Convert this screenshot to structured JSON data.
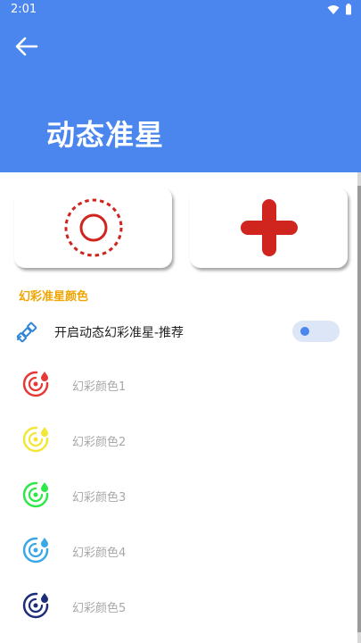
{
  "status_bar": {
    "time": "2:01"
  },
  "header": {
    "title": "动态准星",
    "color": "#4a86ee"
  },
  "cards": [
    {
      "name": "dotted-ring-crosshair"
    },
    {
      "name": "red-plus-crosshair"
    }
  ],
  "section": {
    "title": "幻彩准星颜色"
  },
  "toggle": {
    "label": "开启动态幻彩准星-推荐",
    "enabled": false
  },
  "colors": [
    {
      "label": "幻彩颜色1",
      "color": "#e53935"
    },
    {
      "label": "幻彩颜色2",
      "color": "#f2e637"
    },
    {
      "label": "幻彩颜色3",
      "color": "#2ee84a"
    },
    {
      "label": "幻彩颜色4",
      "color": "#3aa7e6"
    },
    {
      "label": "幻彩颜色5",
      "color": "#1d2d7a"
    }
  ]
}
